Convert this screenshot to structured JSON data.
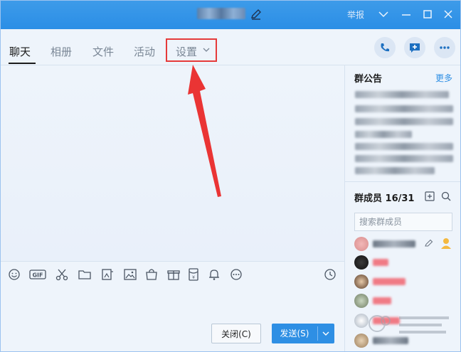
{
  "window": {
    "report_label": "举报"
  },
  "tabs": [
    {
      "label": "聊天"
    },
    {
      "label": "相册"
    },
    {
      "label": "文件"
    },
    {
      "label": "活动"
    },
    {
      "label": "设置"
    }
  ],
  "toolbar": {
    "close_label": "关闭(C)",
    "send_label": "发送(S)"
  },
  "right_panel": {
    "notice_title": "群公告",
    "notice_more": "更多",
    "members_title": "群成员 16/31",
    "search_placeholder": "搜索群成员"
  },
  "colors": {
    "accent": "#2e8fe4",
    "highlight_box": "#e53a3a",
    "title_bar": "#3d9be9"
  },
  "icons": [
    "edit-icon",
    "chevron-down-icon",
    "minimize-icon",
    "maximize-icon",
    "close-icon",
    "phone-icon",
    "add-chat-icon",
    "more-icon",
    "emoji-icon",
    "gif-icon",
    "scissors-icon",
    "folder-icon",
    "image-gallery-icon",
    "image-icon",
    "bag-icon",
    "gift-icon",
    "red-packet-icon",
    "bell-icon",
    "more-circle-icon",
    "history-icon",
    "add-member-icon",
    "search-icon"
  ]
}
